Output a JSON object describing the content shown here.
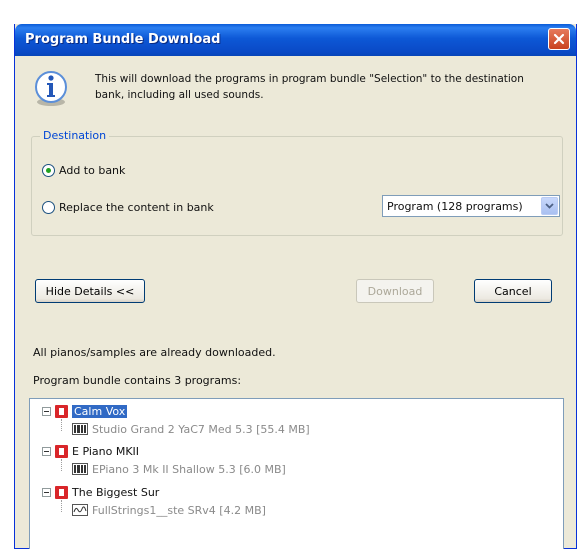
{
  "window": {
    "title": "Program Bundle Download"
  },
  "info": {
    "line1": "This will download the programs in program bundle \"Selection\" to the destination",
    "line2": "bank, including all used sounds."
  },
  "destination": {
    "group_label": "Destination",
    "option_add": "Add to bank",
    "option_replace": "Replace the content in bank",
    "selected_option": "Add to bank",
    "bank_select": "Program (128 programs)"
  },
  "buttons": {
    "hide_details": "Hide Details <<",
    "download": "Download",
    "cancel": "Cancel"
  },
  "details": {
    "status": "All pianos/samples are already downloaded.",
    "summary": "Program bundle contains 3 programs:"
  },
  "tree": {
    "programs": [
      {
        "name": "Calm Vox",
        "sample": "Studio Grand 2 YaC7  Med 5.3 [55.4 MB]",
        "sample_type": "piano-icon"
      },
      {
        "name": "E Piano MKII",
        "sample": "EPiano 3  Mk II Shallow 5.3 [6.0 MB]",
        "sample_type": "piano-icon"
      },
      {
        "name": "The Biggest Sur",
        "sample": "FullStrings1__ste SRv4 [4.2 MB]",
        "sample_type": "wave-icon"
      }
    ]
  },
  "colors": {
    "titlebar": "#0a49c6",
    "accent_label": "#0046d5",
    "program_icon": "#d9262a",
    "selection": "#316ac5"
  }
}
